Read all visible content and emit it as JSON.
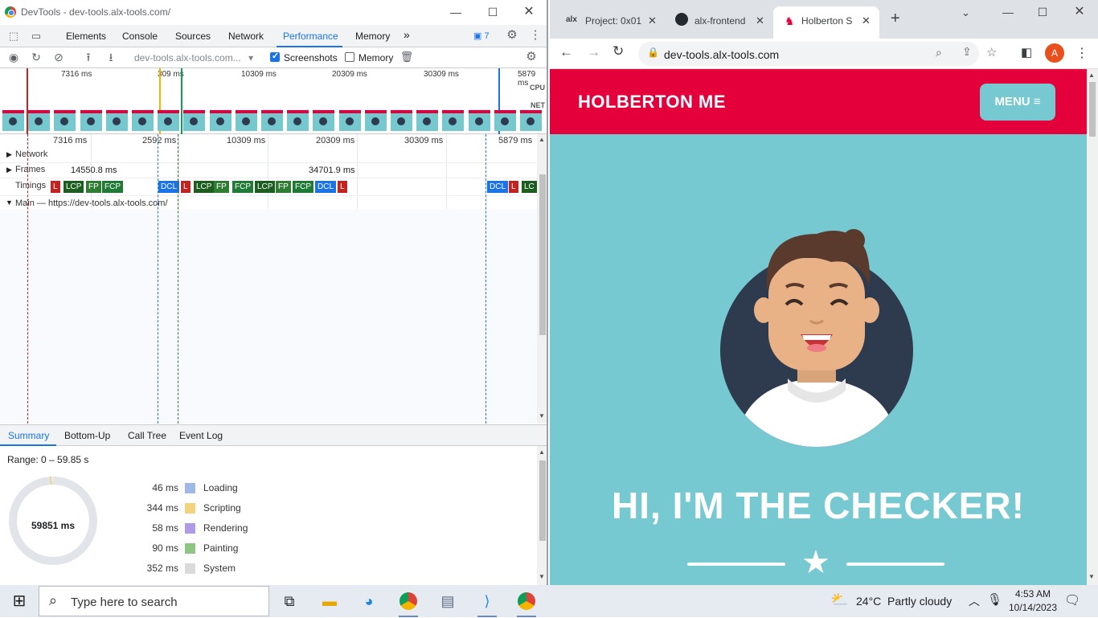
{
  "devtools": {
    "window_title": "DevTools - dev-tools.alx-tools.com/",
    "tabs": [
      "Elements",
      "Console",
      "Sources",
      "Network",
      "Performance",
      "Memory"
    ],
    "more_tabs": "»",
    "issues_count": "7",
    "toolbar": {
      "recording_select": "dev-tools.alx-tools.com...",
      "screenshots_label": "Screenshots",
      "screenshots_checked": true,
      "memory_label": "Memory",
      "memory_checked": false
    },
    "overview": {
      "ticks": [
        "7316 ms",
        "309 ms",
        "10309 ms",
        "20309 ms",
        "30309 ms",
        "5879 ms"
      ],
      "cpu_label": "CPU",
      "net_label": "NET"
    },
    "timeline": {
      "ticks": [
        "7316 ms",
        "2592 ms",
        "10309 ms",
        "20309 ms",
        "30309 ms",
        "5879 ms"
      ],
      "tracks": {
        "network": "Network",
        "frames": "Frames",
        "timings": "Timings",
        "main": "Main — https://dev-tools.alx-tools.com/"
      },
      "frame_durations": [
        "14550.8 ms",
        "34701.9 ms"
      ],
      "markers": [
        "L",
        "LCP",
        "FP",
        "FCP",
        "DCL",
        "L",
        "LCP",
        "FP",
        "FCP",
        "LCP",
        "FP",
        "FCP",
        "DCL",
        "L",
        "DCL",
        "L",
        "LC"
      ]
    },
    "bottom_tabs": [
      "Summary",
      "Bottom-Up",
      "Call Tree",
      "Event Log"
    ],
    "summary": {
      "range": "Range: 0 – 59.85 s",
      "total": "59851 ms",
      "categories": [
        {
          "value": "46 ms",
          "name": "Loading",
          "color": "#9fb8e6"
        },
        {
          "value": "344 ms",
          "name": "Scripting",
          "color": "#f2d27f"
        },
        {
          "value": "58 ms",
          "name": "Rendering",
          "color": "#af9ae8"
        },
        {
          "value": "90 ms",
          "name": "Painting",
          "color": "#8ec484"
        },
        {
          "value": "352 ms",
          "name": "System",
          "color": "#dadada"
        }
      ]
    }
  },
  "browser": {
    "tabs": [
      {
        "title": "Project: 0x01",
        "icon": "alx-icon"
      },
      {
        "title": "alx-frontend",
        "icon": "github-icon"
      },
      {
        "title": "Holberton S",
        "icon": "holberton-icon"
      }
    ],
    "url": "dev-tools.alx-tools.com",
    "profile_initial": "A",
    "site": {
      "logo": "HOLBERTON ME",
      "menu_label": "MENU",
      "hero_title": "HI, I'M THE CHECKER!",
      "colors": {
        "header": "#e4003b",
        "background": "#76c9d1"
      }
    }
  },
  "taskbar": {
    "search_placeholder": "Type here to search",
    "weather": "24°C  Partly cloudy",
    "time": "4:53 AM",
    "date": "10/14/2023"
  }
}
